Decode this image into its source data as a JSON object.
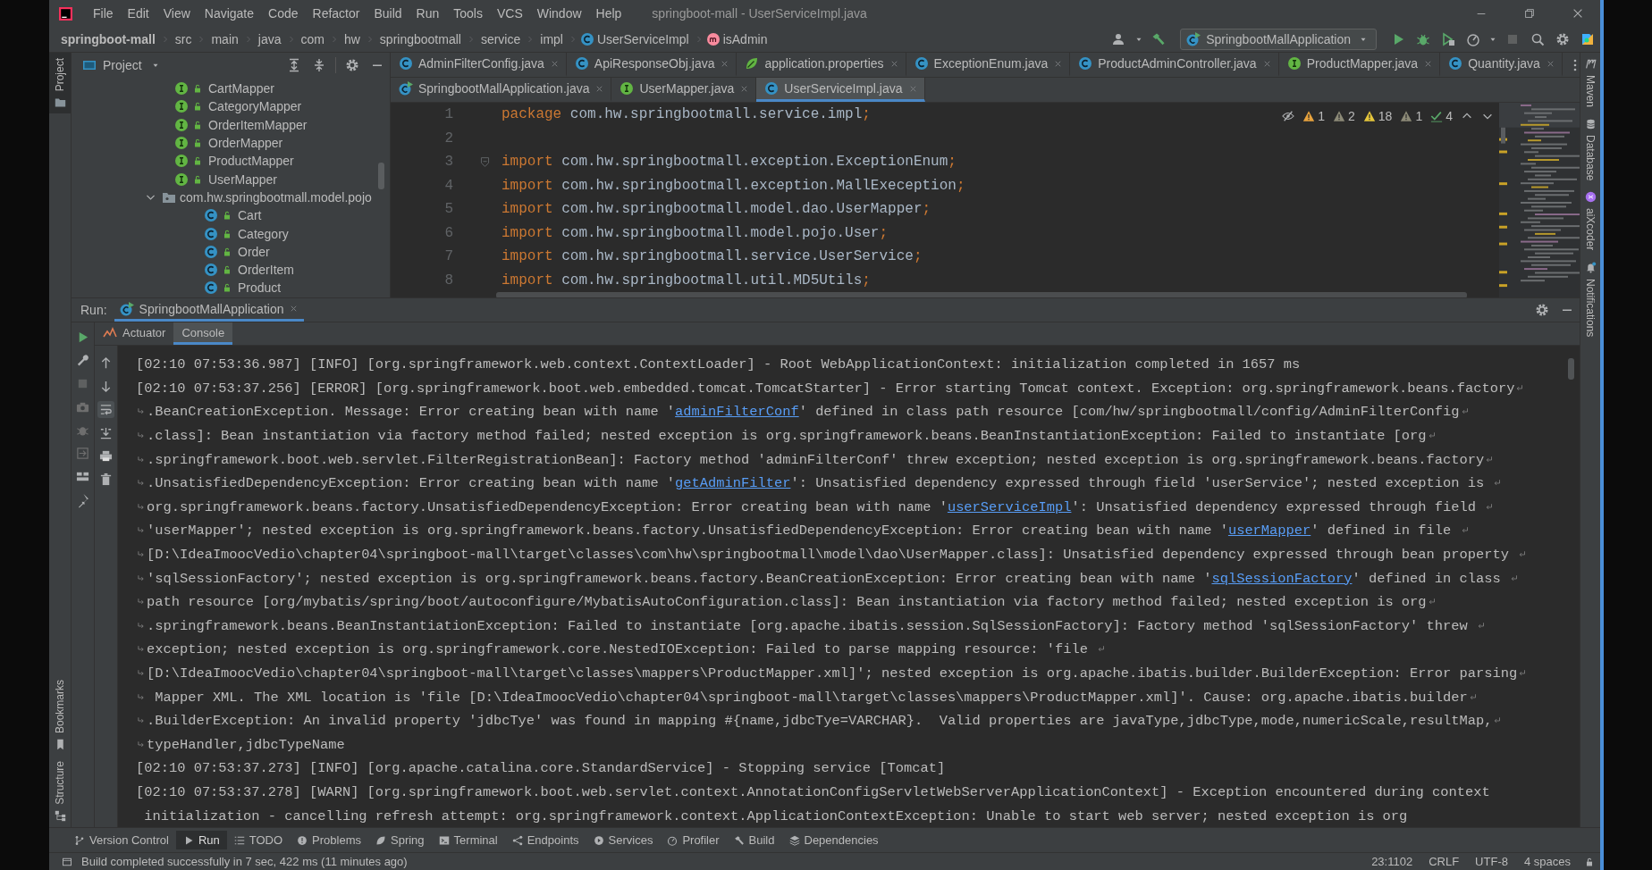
{
  "title_bar": {
    "menu": [
      "File",
      "Edit",
      "View",
      "Navigate",
      "Code",
      "Refactor",
      "Build",
      "Run",
      "Tools",
      "VCS",
      "Window",
      "Help"
    ],
    "title": "springboot-mall - UserServiceImpl.java"
  },
  "breadcrumbs": [
    {
      "label": "springboot-mall",
      "kind": "project"
    },
    {
      "label": "src",
      "kind": "folder"
    },
    {
      "label": "main",
      "kind": "folder"
    },
    {
      "label": "java",
      "kind": "folder"
    },
    {
      "label": "com",
      "kind": "folder"
    },
    {
      "label": "hw",
      "kind": "folder"
    },
    {
      "label": "springbootmall",
      "kind": "folder"
    },
    {
      "label": "service",
      "kind": "folder"
    },
    {
      "label": "impl",
      "kind": "folder"
    },
    {
      "label": "UserServiceImpl",
      "kind": "class"
    },
    {
      "label": "isAdmin",
      "kind": "method"
    }
  ],
  "run_config": "SpringbootMallApplication",
  "left_strip": {
    "top": [
      {
        "label": "Project",
        "kind": "folder",
        "selected": true
      }
    ],
    "bottom": [
      {
        "label": "Bookmarks",
        "kind": "bookmark",
        "selected": false
      },
      {
        "label": "Structure",
        "kind": "structure",
        "selected": false
      }
    ]
  },
  "right_strip": [
    {
      "label": "Maven",
      "kind": "maven"
    },
    {
      "label": "Database",
      "kind": "database"
    },
    {
      "label": "aiXcoder",
      "kind": "aixcoder"
    },
    {
      "label": "Notifications",
      "kind": "bell"
    }
  ],
  "project_panel": {
    "title": "Project",
    "tree": [
      {
        "label": "CartMapper",
        "kind": "interface"
      },
      {
        "label": "CategoryMapper",
        "kind": "interface"
      },
      {
        "label": "OrderItemMapper",
        "kind": "interface"
      },
      {
        "label": "OrderMapper",
        "kind": "interface"
      },
      {
        "label": "ProductMapper",
        "kind": "interface"
      },
      {
        "label": "UserMapper",
        "kind": "interface"
      },
      {
        "label": "com.hw.springbootmall.model.pojo",
        "kind": "package",
        "expanded": true,
        "children": [
          {
            "label": "Cart",
            "kind": "class"
          },
          {
            "label": "Category",
            "kind": "class"
          },
          {
            "label": "Order",
            "kind": "class"
          },
          {
            "label": "OrderItem",
            "kind": "class"
          },
          {
            "label": "Product",
            "kind": "class"
          }
        ]
      }
    ]
  },
  "editor_tab_rows": [
    {
      "tabs": [
        {
          "label": "AdminFilterConfig.java",
          "kind": "class",
          "selected": false
        },
        {
          "label": "ApiResponseObj.java",
          "kind": "class",
          "selected": false
        },
        {
          "label": "application.properties",
          "kind": "properties",
          "selected": false
        },
        {
          "label": "ExceptionEnum.java",
          "kind": "class",
          "selected": false
        },
        {
          "label": "ProductAdminController.java",
          "kind": "class",
          "selected": false
        },
        {
          "label": "ProductMapper.java",
          "kind": "interface",
          "selected": false
        },
        {
          "label": "Quantity.java",
          "kind": "class",
          "selected": false
        }
      ]
    },
    {
      "tabs": [
        {
          "label": "SpringbootMallApplication.java",
          "kind": "app",
          "selected": false
        },
        {
          "label": "UserMapper.java",
          "kind": "interface",
          "selected": false
        },
        {
          "label": "UserServiceImpl.java",
          "kind": "class",
          "selected": true
        }
      ]
    }
  ],
  "inspections": [
    {
      "kind": "error",
      "count": "1"
    },
    {
      "kind": "weak",
      "count": "2"
    },
    {
      "kind": "warning",
      "count": "18"
    },
    {
      "kind": "weak",
      "count": "1"
    },
    {
      "kind": "ok",
      "count": "4"
    }
  ],
  "code_lines": [
    {
      "number": "1",
      "tokens": [
        {
          "text": "package",
          "kind": "keyword"
        },
        {
          "text": " com.hw.springbootmall.service.impl",
          "kind": "plain"
        },
        {
          "text": ";",
          "kind": "punct"
        }
      ]
    },
    {
      "number": "2"
    },
    {
      "number": "3",
      "fold": true,
      "tokens": [
        {
          "text": "import",
          "kind": "keyword"
        },
        {
          "text": " com.hw.springbootmall.exception.ExceptionEnum",
          "kind": "plain"
        },
        {
          "text": ";",
          "kind": "punct"
        }
      ]
    },
    {
      "number": "4",
      "tokens": [
        {
          "text": "import",
          "kind": "keyword"
        },
        {
          "text": " com.hw.springbootmall.exception.MallExeception",
          "kind": "plain"
        },
        {
          "text": ";",
          "kind": "punct"
        }
      ]
    },
    {
      "number": "5",
      "tokens": [
        {
          "text": "import",
          "kind": "keyword"
        },
        {
          "text": " com.hw.springbootmall.model.dao.UserMapper",
          "kind": "plain"
        },
        {
          "text": ";",
          "kind": "punct"
        }
      ]
    },
    {
      "number": "6",
      "tokens": [
        {
          "text": "import",
          "kind": "keyword"
        },
        {
          "text": " com.hw.springbootmall.model.pojo.User",
          "kind": "plain"
        },
        {
          "text": ";",
          "kind": "punct"
        }
      ]
    },
    {
      "number": "7",
      "tokens": [
        {
          "text": "import",
          "kind": "keyword"
        },
        {
          "text": " com.hw.springbootmall.service.UserService",
          "kind": "plain"
        },
        {
          "text": ";",
          "kind": "punct"
        }
      ]
    },
    {
      "number": "8",
      "tokens": [
        {
          "text": "import",
          "kind": "keyword"
        },
        {
          "text": " com.hw.springbootmall.util.MD5Utils",
          "kind": "plain"
        },
        {
          "text": ";",
          "kind": "punct"
        }
      ]
    }
  ],
  "run_panel": {
    "label": "Run:",
    "tab": "SpringbootMallApplication",
    "subtabs": [
      {
        "label": "Actuator",
        "kind": "actuator",
        "selected": false
      },
      {
        "label": "Console",
        "kind": "console",
        "selected": true
      }
    ],
    "console_lines": [
      {
        "continued": false,
        "wraps": false,
        "parts": [
          {
            "kind": "text",
            "text": "[02:10 07:53:36.987] [INFO] [org.springframework.web.context.ContextLoader] - Root WebApplicationContext: initialization completed in 1657 ms"
          }
        ]
      },
      {
        "continued": false,
        "wraps": true,
        "parts": [
          {
            "kind": "text",
            "text": "[02:10 07:53:37.256] [ERROR] [org.springframework.boot.web.embedded.tomcat.TomcatStarter] - Error starting Tomcat context. Exception: org.springframework.beans.factory"
          }
        ]
      },
      {
        "continued": true,
        "wraps": true,
        "parts": [
          {
            "kind": "text",
            "text": ".BeanCreationException. Message: Error creating bean with name '"
          },
          {
            "kind": "link",
            "text": "adminFilterConf"
          },
          {
            "kind": "text",
            "text": "' defined in class path resource [com/hw/springbootmall/config/AdminFilterConfig"
          }
        ]
      },
      {
        "continued": true,
        "wraps": true,
        "parts": [
          {
            "kind": "text",
            "text": ".class]: Bean instantiation via factory method failed; nested exception is org.springframework.beans.BeanInstantiationException: Failed to instantiate [org"
          }
        ]
      },
      {
        "continued": true,
        "wraps": true,
        "parts": [
          {
            "kind": "text",
            "text": ".springframework.boot.web.servlet.FilterRegistrationBean]: Factory method 'adminFilterConf' threw exception; nested exception is org.springframework.beans.factory"
          }
        ]
      },
      {
        "continued": true,
        "wraps": true,
        "parts": [
          {
            "kind": "text",
            "text": ".UnsatisfiedDependencyException: Error creating bean with name '"
          },
          {
            "kind": "link",
            "text": "getAdminFilter"
          },
          {
            "kind": "text",
            "text": "': Unsatisfied dependency expressed through field 'userService'; nested exception is "
          }
        ]
      },
      {
        "continued": true,
        "wraps": true,
        "parts": [
          {
            "kind": "text",
            "text": "org.springframework.beans.factory.UnsatisfiedDependencyException: Error creating bean with name '"
          },
          {
            "kind": "link",
            "text": "userServiceImpl"
          },
          {
            "kind": "text",
            "text": "': Unsatisfied dependency expressed through field "
          }
        ]
      },
      {
        "continued": true,
        "wraps": true,
        "parts": [
          {
            "kind": "text",
            "text": "'userMapper'; nested exception is org.springframework.beans.factory.UnsatisfiedDependencyException: Error creating bean with name '"
          },
          {
            "kind": "link",
            "text": "userMapper"
          },
          {
            "kind": "text",
            "text": "' defined in file "
          }
        ]
      },
      {
        "continued": true,
        "wraps": true,
        "parts": [
          {
            "kind": "text",
            "text": "[D:\\IdeaImoocVedio\\chapter04\\springboot-mall\\target\\classes\\com\\hw\\springbootmall\\model\\dao\\UserMapper.class]: Unsatisfied dependency expressed through bean property "
          }
        ]
      },
      {
        "continued": true,
        "wraps": true,
        "parts": [
          {
            "kind": "text",
            "text": "'sqlSessionFactory'; nested exception is org.springframework.beans.factory.BeanCreationException: Error creating bean with name '"
          },
          {
            "kind": "link",
            "text": "sqlSessionFactory"
          },
          {
            "kind": "text",
            "text": "' defined in class "
          }
        ]
      },
      {
        "continued": true,
        "wraps": true,
        "parts": [
          {
            "kind": "text",
            "text": "path resource [org/mybatis/spring/boot/autoconfigure/MybatisAutoConfiguration.class]: Bean instantiation via factory method failed; nested exception is org"
          }
        ]
      },
      {
        "continued": true,
        "wraps": true,
        "parts": [
          {
            "kind": "text",
            "text": ".springframework.beans.BeanInstantiationException: Failed to instantiate [org.apache.ibatis.session.SqlSessionFactory]: Factory method 'sqlSessionFactory' threw "
          }
        ]
      },
      {
        "continued": true,
        "wraps": true,
        "parts": [
          {
            "kind": "text",
            "text": "exception; nested exception is org.springframework.core.NestedIOException: Failed to parse mapping resource: 'file "
          }
        ]
      },
      {
        "continued": true,
        "wraps": true,
        "parts": [
          {
            "kind": "text",
            "text": "[D:\\IdeaImoocVedio\\chapter04\\springboot-mall\\target\\classes\\mappers\\ProductMapper.xml]'; nested exception is org.apache.ibatis.builder.BuilderException: Error parsing"
          }
        ]
      },
      {
        "continued": true,
        "wraps": true,
        "parts": [
          {
            "kind": "text",
            "text": " Mapper XML. The XML location is 'file [D:\\IdeaImoocVedio\\chapter04\\springboot-mall\\target\\classes\\mappers\\ProductMapper.xml]'. Cause: org.apache.ibatis.builder"
          }
        ]
      },
      {
        "continued": true,
        "wraps": true,
        "parts": [
          {
            "kind": "text",
            "text": ".BuilderException: An invalid property 'jdbcTye' was found in mapping #{name,jdbcTye=VARCHAR}.  Valid properties are javaType,jdbcType,mode,numericScale,resultMap,"
          }
        ]
      },
      {
        "continued": true,
        "wraps": false,
        "parts": [
          {
            "kind": "text",
            "text": "typeHandler,jdbcTypeName"
          }
        ]
      },
      {
        "continued": false,
        "wraps": false,
        "parts": [
          {
            "kind": "text",
            "text": "[02:10 07:53:37.273] [INFO] [org.apache.catalina.core.StandardService] - Stopping service [Tomcat]"
          }
        ]
      },
      {
        "continued": false,
        "wraps": false,
        "parts": [
          {
            "kind": "text",
            "text": "[02:10 07:53:37.278] [WARN] [org.springframework.boot.web.servlet.context.AnnotationConfigServletWebServerApplicationContext] - Exception encountered during context"
          }
        ]
      },
      {
        "continued": false,
        "wraps": false,
        "parts": [
          {
            "kind": "text",
            "text": " initialization - cancelling refresh attempt: org.springframework.context.ApplicationContextException: Unable to start web server; nested exception is org"
          }
        ]
      }
    ]
  },
  "tool_windows": [
    {
      "label": "Version Control",
      "kind": "vcs",
      "selected": false
    },
    {
      "label": "Run",
      "kind": "run",
      "selected": true
    },
    {
      "label": "TODO",
      "kind": "todo",
      "selected": false
    },
    {
      "label": "Problems",
      "kind": "problems",
      "selected": false
    },
    {
      "label": "Spring",
      "kind": "spring",
      "selected": false
    },
    {
      "label": "Terminal",
      "kind": "terminal",
      "selected": false
    },
    {
      "label": "Endpoints",
      "kind": "endpoints",
      "selected": false
    },
    {
      "label": "Services",
      "kind": "services",
      "selected": false
    },
    {
      "label": "Profiler",
      "kind": "profiler",
      "selected": false
    },
    {
      "label": "Build",
      "kind": "build",
      "selected": false
    },
    {
      "label": "Dependencies",
      "kind": "dependencies",
      "selected": false
    }
  ],
  "status_bar": {
    "message": "Build completed successfully in 7 sec, 422 ms (11 minutes ago)",
    "items": [
      "23:1102",
      "CRLF",
      "UTF-8",
      "4 spaces"
    ]
  }
}
